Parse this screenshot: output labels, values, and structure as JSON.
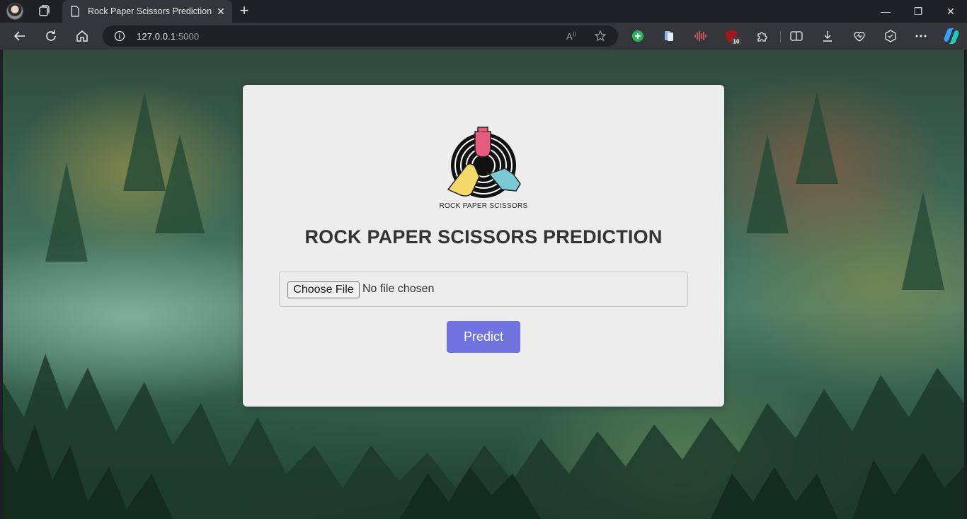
{
  "browser": {
    "tab": {
      "title": "Rock Paper Scissors Prediction",
      "favicon": "page-icon"
    },
    "address": {
      "host": "127.0.0.1",
      "port": ":5000"
    },
    "extensions": {
      "badge_count": "10"
    },
    "colors": {
      "chrome": "#202124",
      "toolbar": "#35363a"
    }
  },
  "page": {
    "logo": {
      "caption": "ROCK PAPER SCISSORS"
    },
    "title": "ROCK PAPER SCISSORS PREDICTION",
    "file_input": {
      "button_label": "Choose File",
      "status": "No file chosen"
    },
    "predict_button": {
      "label": "Predict"
    },
    "colors": {
      "card": "#ededed",
      "button": "#7174e0",
      "title": "#333333"
    }
  }
}
